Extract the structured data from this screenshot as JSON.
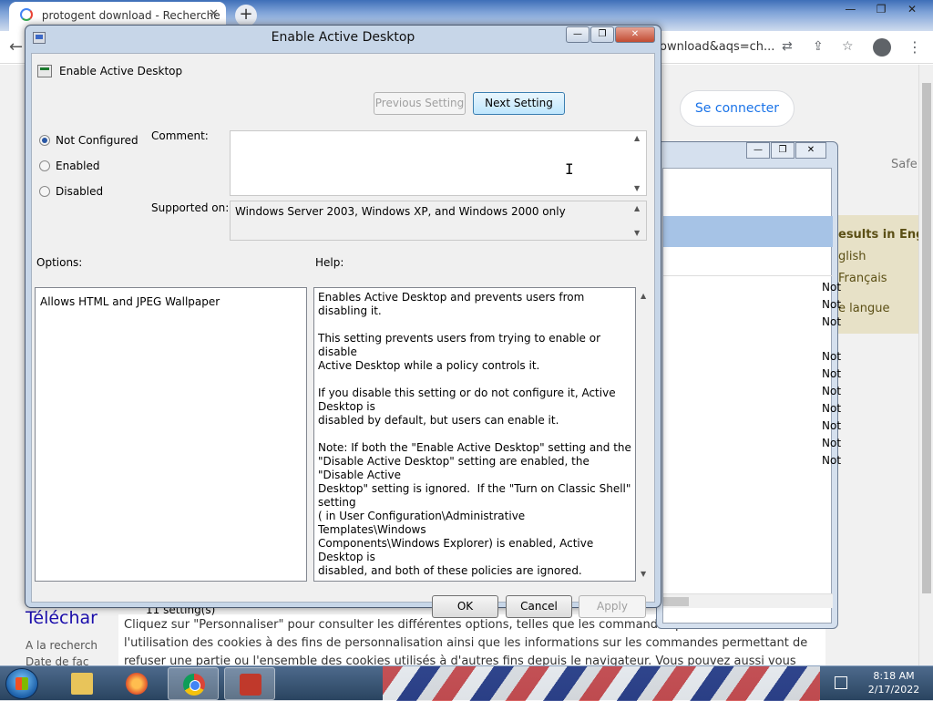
{
  "browser": {
    "tab_title": "protogent download - Recherche",
    "tab_close": "✕",
    "new_tab": "+",
    "omnibox_tail": "ownload&aqs=ch...",
    "window_controls": {
      "minimize": "—",
      "restore": "❐",
      "close": "✕"
    }
  },
  "page": {
    "sign_in": "Se connecter",
    "safe": "Safe",
    "lang_results": "esults in Engli",
    "lang_english": "glish",
    "lang_french": "Français",
    "lang_change": "e langue",
    "download_heading": "Téléchar",
    "search_para_1": "A la recherch",
    "search_para_2": "Date de fac",
    "cookie_line_1": "Cliquez sur \"Personnaliser\" pour consulter les différentes options, telles que les commandes permettant de refuser",
    "cookie_line_2": "l'utilisation des cookies à des fins de personnalisation ainsi que les informations sur les commandes permettant de",
    "cookie_line_3": "refuser une partie ou l'ensemble des cookies utilisés à d'autres fins depuis le navigateur. Vous pouvez aussi vous"
  },
  "gpo": {
    "not_items": [
      "Not",
      "Not",
      "Not",
      "Not",
      "Not",
      "Not",
      "Not",
      "Not",
      "Not",
      "Not"
    ],
    "status": "11 setting(s)"
  },
  "dialog": {
    "title": "Enable Active Desktop",
    "setting_name": "Enable Active Desktop",
    "prev_button": "Previous Setting",
    "next_button": "Next Setting",
    "radios": {
      "not_configured": "Not Configured",
      "enabled": "Enabled",
      "disabled": "Disabled",
      "selected": "not_configured"
    },
    "comment_label": "Comment:",
    "comment_value": "",
    "supported_label": "Supported on:",
    "supported_value": "Windows Server 2003, Windows XP, and Windows 2000 only",
    "options_label": "Options:",
    "help_label": "Help:",
    "options_text": "Allows HTML and JPEG Wallpaper",
    "help_text": "Enables Active Desktop and prevents users from disabling it.\n\nThis setting prevents users from trying to enable or disable\nActive Desktop while a policy controls it.\n\nIf you disable this setting or do not configure it, Active Desktop is\ndisabled by default, but users can enable it.\n\nNote: If both the \"Enable Active Desktop\" setting and the\n\"Disable Active Desktop\" setting are enabled, the \"Disable Active\nDesktop\" setting is ignored.  If the \"Turn on Classic Shell\" setting\n( in User Configuration\\Administrative Templates\\Windows\nComponents\\Windows Explorer) is enabled, Active Desktop is\ndisabled, and both of these policies are ignored.",
    "ok": "OK",
    "cancel": "Cancel",
    "apply": "Apply"
  },
  "taskbar": {
    "time": "8:18 AM",
    "date": "2/17/2022"
  }
}
